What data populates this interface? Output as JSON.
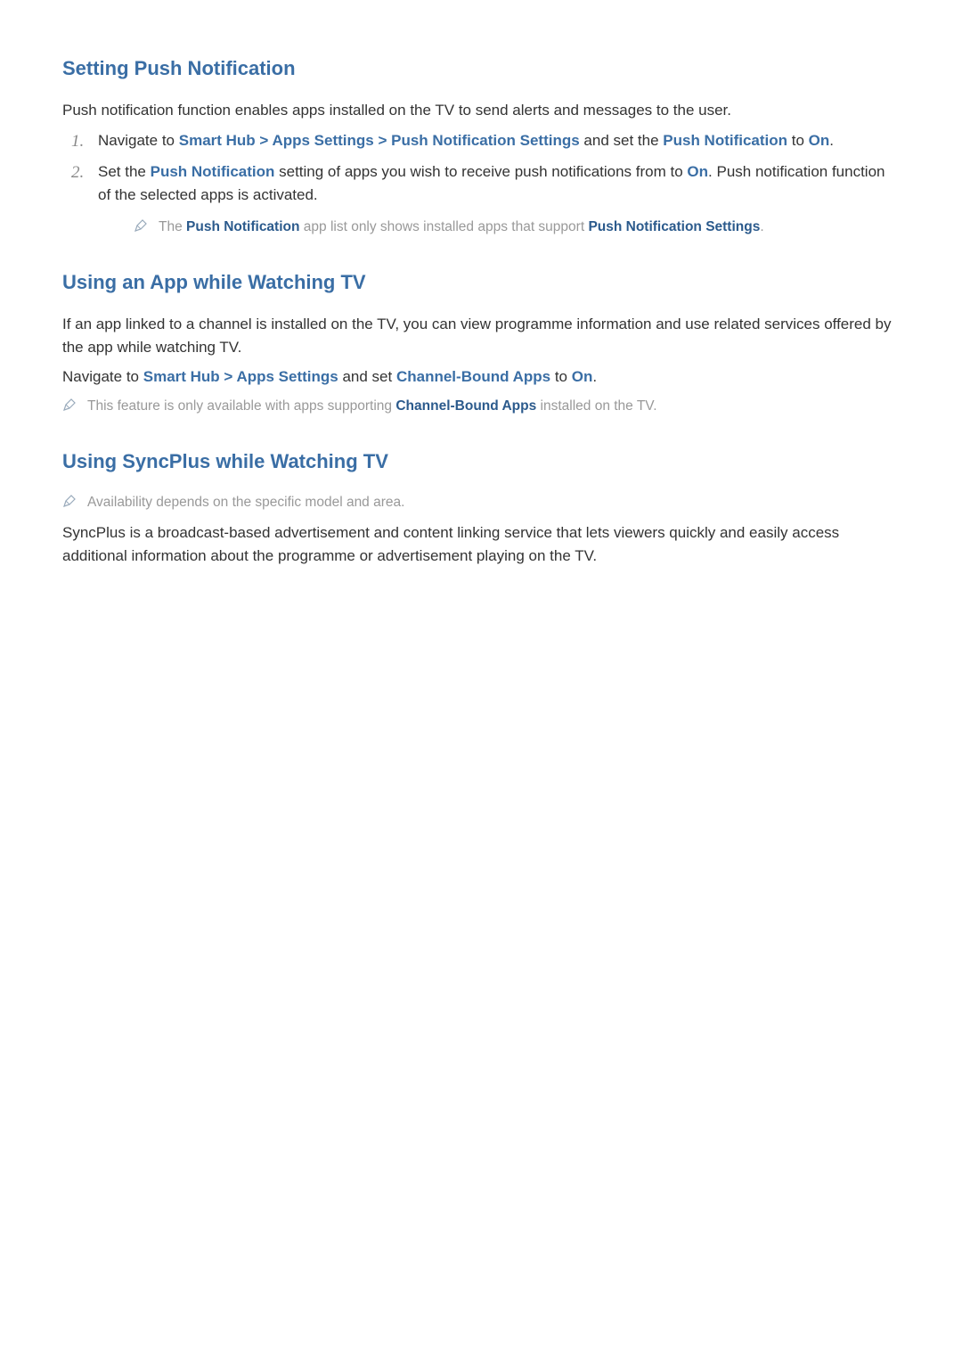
{
  "section1": {
    "heading": "Setting Push Notification",
    "intro": "Push notification function enables apps installed on the TV to send alerts and messages to the user.",
    "step1_pre": "Navigate to ",
    "step1_link1": "Smart Hub",
    "step1_sep": " > ",
    "step1_link2": "Apps Settings",
    "step1_link3": "Push Notification Settings",
    "step1_mid": " and set the ",
    "step1_link4": "Push Notification",
    "step1_to": " to ",
    "step1_on": "On",
    "step1_end": ".",
    "step2_pre": "Set the ",
    "step2_link1": "Push Notification",
    "step2_mid": " setting of apps you wish to receive push notifications from to ",
    "step2_on": "On",
    "step2_end": ". Push notification function of the selected apps is activated.",
    "note1_pre": "The ",
    "note1_link1": "Push Notification",
    "note1_mid": " app list only shows installed apps that support ",
    "note1_link2": "Push Notification Settings",
    "note1_end": "."
  },
  "section2": {
    "heading": "Using an App while Watching TV",
    "intro": "If an app linked to a channel is installed on the TV, you can view programme information and use related services offered by the app while watching TV.",
    "nav_pre": "Navigate to ",
    "nav_link1": "Smart Hub",
    "nav_sep": " > ",
    "nav_link2": "Apps Settings",
    "nav_mid": " and set ",
    "nav_link3": "Channel-Bound Apps",
    "nav_to": " to ",
    "nav_on": "On",
    "nav_end": ".",
    "note_pre": "This feature is only available with apps supporting ",
    "note_link": "Channel-Bound Apps",
    "note_end": " installed on the TV."
  },
  "section3": {
    "heading": "Using SyncPlus while Watching TV",
    "note": "Availability depends on the specific model and area.",
    "body": "SyncPlus is a broadcast-based advertisement and content linking service that lets viewers quickly and easily access additional information about the programme or advertisement playing on the TV."
  }
}
